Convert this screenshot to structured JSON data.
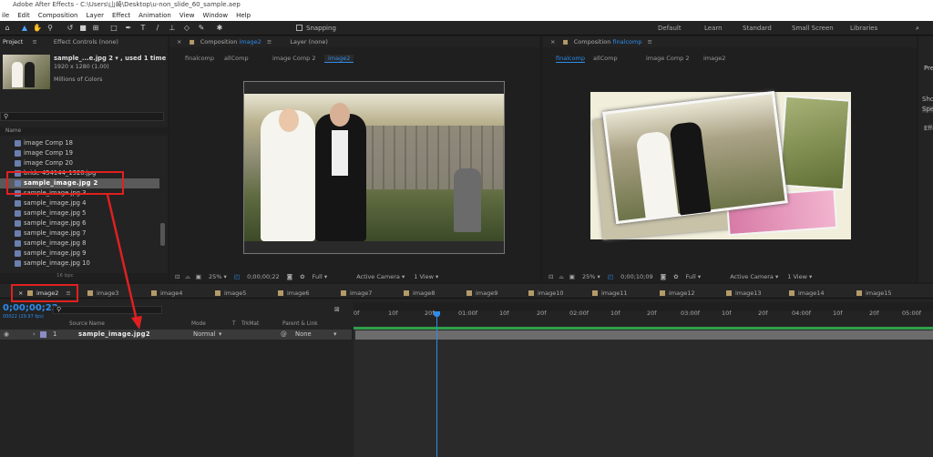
{
  "window": {
    "title": "Adobe After Effects - C:\\Users\\山崎\\Desktop\\u-non_slide_60_sample.aep"
  },
  "menu": [
    "ile",
    "Edit",
    "Composition",
    "Layer",
    "Effect",
    "Animation",
    "View",
    "Window",
    "Help"
  ],
  "toolbar": {
    "snapping": "Snapping",
    "workspaces": [
      "Default",
      "Learn",
      "Standard",
      "Small Screen",
      "Libraries"
    ]
  },
  "project": {
    "tab": "Project",
    "effect_controls": "Effect Controls (none)",
    "selected_name": "sample_...e.jpg 2 ▾ , used 1 time",
    "dims": "1920 x 1280 (1.00)",
    "colors": "Millions of Colors",
    "col_name": "Name",
    "items": [
      "image Comp 18",
      "image Comp 19",
      "image Comp 20",
      "bride-454144_1920.jpg",
      "sample_image.jpg 2",
      "sample_image.jpg 3",
      "sample_image.jpg 4",
      "sample_image.jpg 5",
      "sample_image.jpg 6",
      "sample_image.jpg 7",
      "sample_image.jpg 8",
      "sample_image.jpg 9",
      "sample_image.jpg 10"
    ],
    "bpc": "16 bpc"
  },
  "comp_left": {
    "tab": "Composition",
    "tab_name": "image2",
    "layer_tab": "Layer (none)",
    "crumbs": [
      "finalcomp",
      "allComp",
      "image Comp 2",
      "image2"
    ],
    "zoom": "25%",
    "time": "0;00;00;22",
    "res": "Full",
    "camera": "Active Camera",
    "view": "1 View"
  },
  "comp_right": {
    "tab": "Composition",
    "tab_name": "finalcomp",
    "crumbs": [
      "finalcomp",
      "allComp",
      "image Comp 2",
      "image2"
    ],
    "zoom": "25%",
    "time": "0;00;10;09",
    "res": "Full",
    "camera": "Active Camera",
    "view": "1 View"
  },
  "right_panel": {
    "a": "Pre",
    "b": "Sho",
    "c": "Spe",
    "d": "Effe"
  },
  "timeline": {
    "tabs": [
      "image2",
      "image3",
      "image4",
      "image5",
      "image6",
      "image7",
      "image8",
      "image9",
      "image10",
      "image11",
      "image12",
      "image13",
      "image14",
      "image15"
    ],
    "time": "0;00;00;22",
    "time_sub": "00022 (29.97 fps)",
    "cols": {
      "source": "Source Name",
      "mode": "Mode",
      "t": "T",
      "trkmat": "TrkMat",
      "parent": "Parent & Link"
    },
    "layer": {
      "num": "1",
      "name": "sample_image.jpg2",
      "mode": "Normal",
      "parent": "None"
    },
    "ruler": [
      "0f",
      "10f",
      "20f",
      "01:00f",
      "10f",
      "20f",
      "02:00f",
      "10f",
      "20f",
      "03:00f",
      "10f",
      "20f",
      "04:00f",
      "10f",
      "20f",
      "05:00f"
    ]
  },
  "colors": {
    "accent": "#2d8ceb",
    "annotation": "#e02020"
  }
}
